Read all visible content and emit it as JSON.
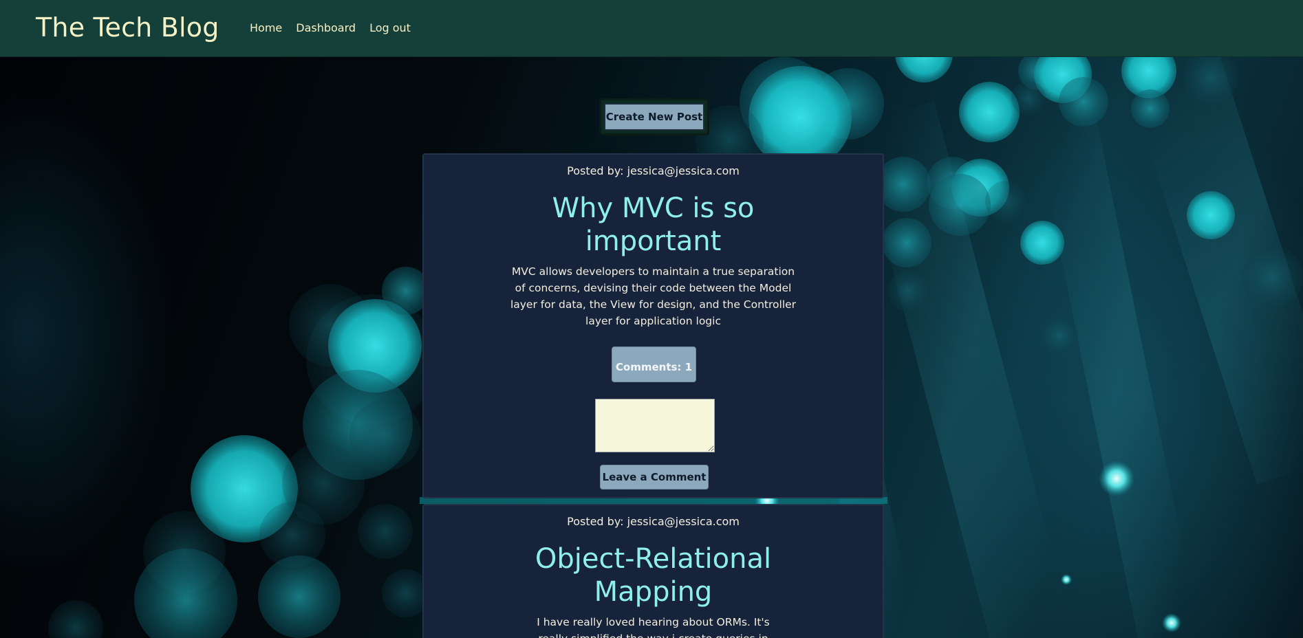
{
  "nav": {
    "brand": "The Tech Blog",
    "links": [
      "Home",
      "Dashboard",
      "Log out"
    ]
  },
  "create_button_label": "Create New Post",
  "colors": {
    "nav_bg": "#15403a",
    "nav_text": "#f4f1c6",
    "card_bg": "#16233a",
    "title_color": "#8ff0ea",
    "button_bg": "#8ca8bc",
    "comment_input_bg": "#f6f8dc"
  },
  "posts": [
    {
      "posted_by": "Posted by: jessica@jessica.com",
      "title": "Why MVC is so important",
      "body": "MVC allows developers to maintain a true separation of concerns, devising their code between the Model layer for data, the View for design, and the Controller layer for application logic",
      "comments_label": "Comments: 1",
      "leave_comment_label": "Leave a Comment"
    },
    {
      "posted_by": "Posted by: jessica@jessica.com",
      "title": "Object-Relational Mapping",
      "body": "I have really loved hearing about ORMs. It's really simplified the way i create queries in SQL!"
    }
  ]
}
